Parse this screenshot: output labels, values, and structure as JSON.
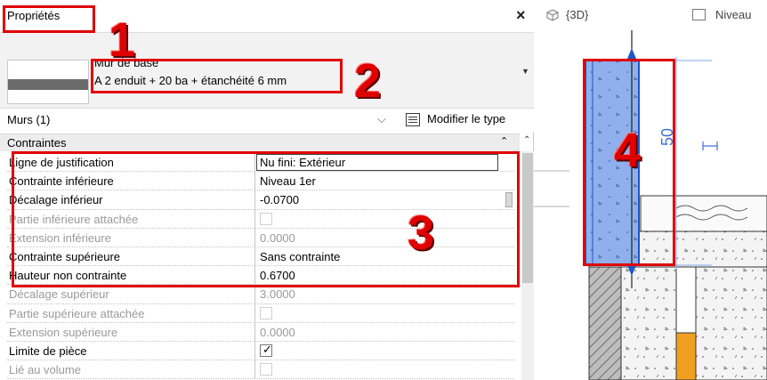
{
  "properties": {
    "title": "Propriétés",
    "type_family": "Mur de base",
    "type_name": "A 2 enduit + 20 ba + étanchéité 6 mm",
    "filter_label": "Murs (1)",
    "edit_type_label": "Modifier le type",
    "group_label": "Contraintes",
    "rows": [
      {
        "label": "Ligne de justification",
        "value": "Nu fini: Extérieur"
      },
      {
        "label": "Contrainte inférieure",
        "value": "Niveau 1er"
      },
      {
        "label": "Décalage inférieur",
        "value": "-0.0700"
      },
      {
        "label": "Partie inférieure attachée",
        "value": ""
      },
      {
        "label": "Extension inférieure",
        "value": "0.0000"
      },
      {
        "label": "Contrainte supérieure",
        "value": "Sans contrainte"
      },
      {
        "label": "Hauteur non contrainte",
        "value": "0.6700"
      },
      {
        "label": "Décalage supérieur",
        "value": "3.0000"
      },
      {
        "label": "Partie supérieure attachée",
        "value": ""
      },
      {
        "label": "Extension supérieure",
        "value": "0.0000"
      },
      {
        "label": "Limite de pièce",
        "value": "checked"
      },
      {
        "label": "Lié au volume",
        "value": ""
      }
    ]
  },
  "view": {
    "tab_3d": "{3D}",
    "tab_level": "Niveau",
    "dimension_label": "50"
  },
  "annotations": [
    "1",
    "2",
    "3",
    "4"
  ],
  "colors": {
    "annotation_red": "#e00000",
    "wall_blue": "#7da0e6",
    "beam_orange": "#f0a020",
    "hatch_gray": "#9e9e9e"
  }
}
